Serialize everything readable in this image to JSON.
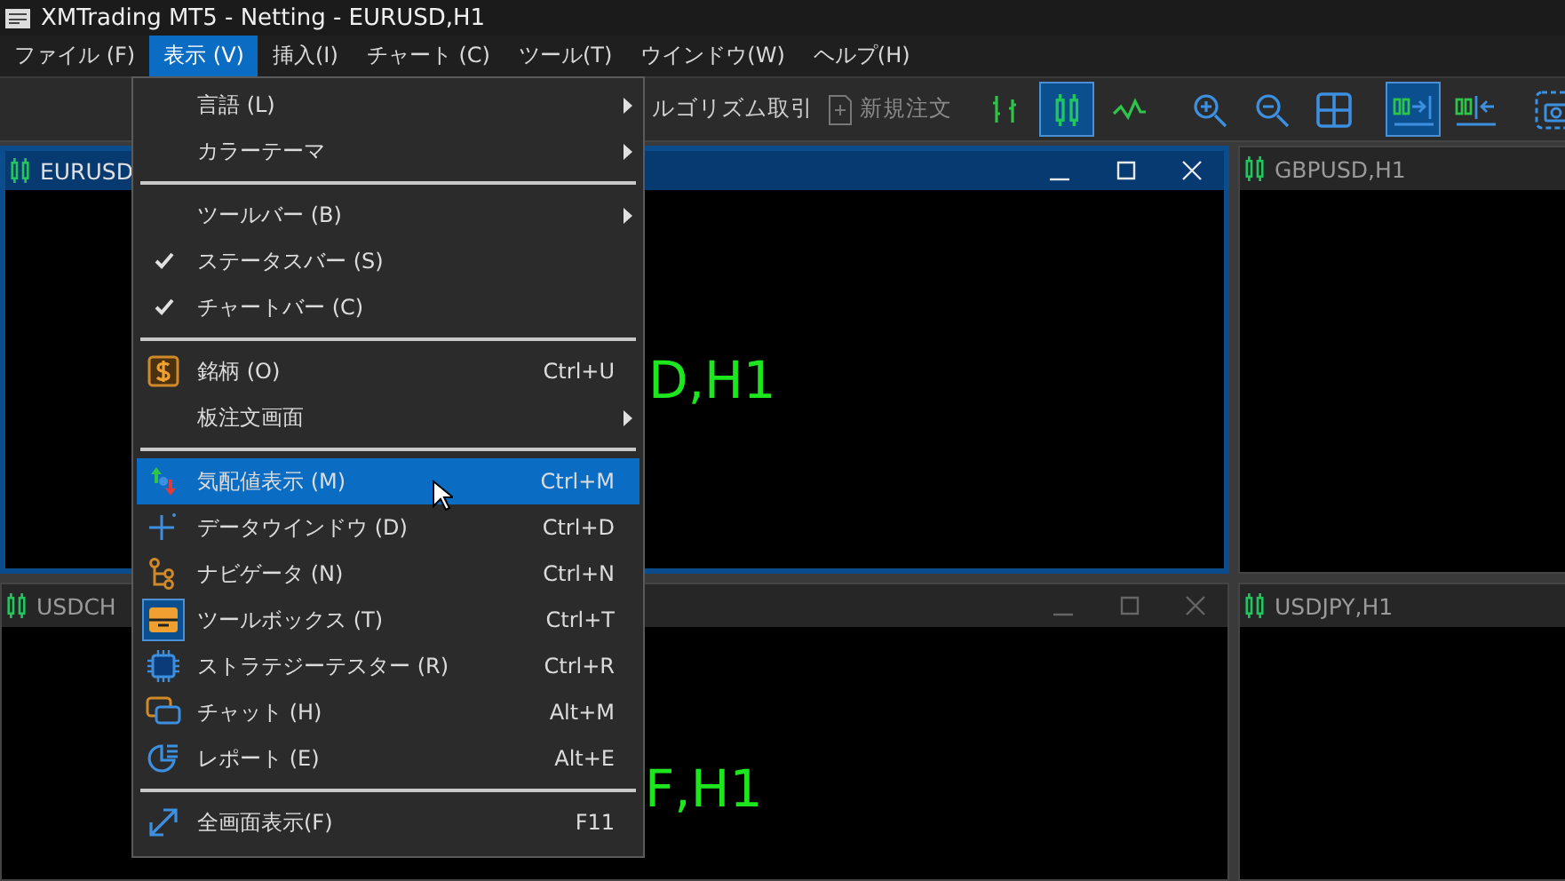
{
  "window": {
    "title": "XMTrading MT5 - Netting - EURUSD,H1"
  },
  "menubar": [
    {
      "label": "ファイル (F)",
      "selected": false
    },
    {
      "label": "表示 (V)",
      "selected": true
    },
    {
      "label": "挿入(I)",
      "selected": false
    },
    {
      "label": "チャート (C)",
      "selected": false
    },
    {
      "label": "ツール(T)",
      "selected": false
    },
    {
      "label": "ウインドウ(W)",
      "selected": false
    },
    {
      "label": "ヘルプ(H)",
      "selected": false
    }
  ],
  "toolbar": {
    "algo_trading": "ルゴリズム取引",
    "new_order": "新規注文",
    "buttons": [
      {
        "selected": false
      },
      {
        "selected": true
      },
      {
        "selected": false
      },
      {
        "selected": false
      },
      {
        "selected": false
      },
      {
        "selected": false
      },
      {
        "selected": true
      },
      {
        "selected": false
      },
      {
        "selected": false
      }
    ]
  },
  "charts": [
    {
      "title": "EURUSD",
      "symbol": "D,H1",
      "selected": true,
      "controls": true
    },
    {
      "title": "GBPUSD,H1",
      "selected": false
    },
    {
      "title": "USDCH",
      "symbol": "F,H1",
      "selected": false,
      "controls": true
    },
    {
      "title": "USDJPY,H1",
      "selected": false
    }
  ],
  "view_menu": {
    "groups": [
      [
        {
          "label": "言語 (L)",
          "submenu": true,
          "selected": false
        },
        {
          "label": "カラーテーマ",
          "submenu": true,
          "selected": false
        }
      ],
      [
        {
          "label": "ツールバー (B)",
          "submenu": true,
          "checked": false,
          "selected": false
        },
        {
          "label": "ステータスバー (S)",
          "submenu": false,
          "checked": true,
          "selected": false
        },
        {
          "label": "チャートバー (C)",
          "submenu": false,
          "checked": true,
          "selected": false
        }
      ],
      [
        {
          "label": "銘柄 (O)",
          "shortcut": "Ctrl+U",
          "selected": false
        },
        {
          "label": "板注文画面",
          "submenu": true,
          "selected": false
        }
      ],
      [
        {
          "label": "気配値表示 (M)",
          "shortcut": "Ctrl+M",
          "selected": true
        },
        {
          "label": "データウインドウ (D)",
          "shortcut": "Ctrl+D",
          "selected": false
        },
        {
          "label": "ナビゲータ (N)",
          "shortcut": "Ctrl+N",
          "selected": false
        },
        {
          "label": "ツールボックス (T)",
          "shortcut": "Ctrl+T",
          "selected": false
        },
        {
          "label": "ストラテジーテスター (R)",
          "shortcut": "Ctrl+R",
          "selected": false
        },
        {
          "label": "チャット (H)",
          "shortcut": "Alt+M",
          "selected": false
        },
        {
          "label": "レポート (E)",
          "shortcut": "Alt+E",
          "selected": false
        }
      ],
      [
        {
          "label": "全画面表示(F)",
          "shortcut": "F11",
          "selected": false
        }
      ]
    ]
  }
}
